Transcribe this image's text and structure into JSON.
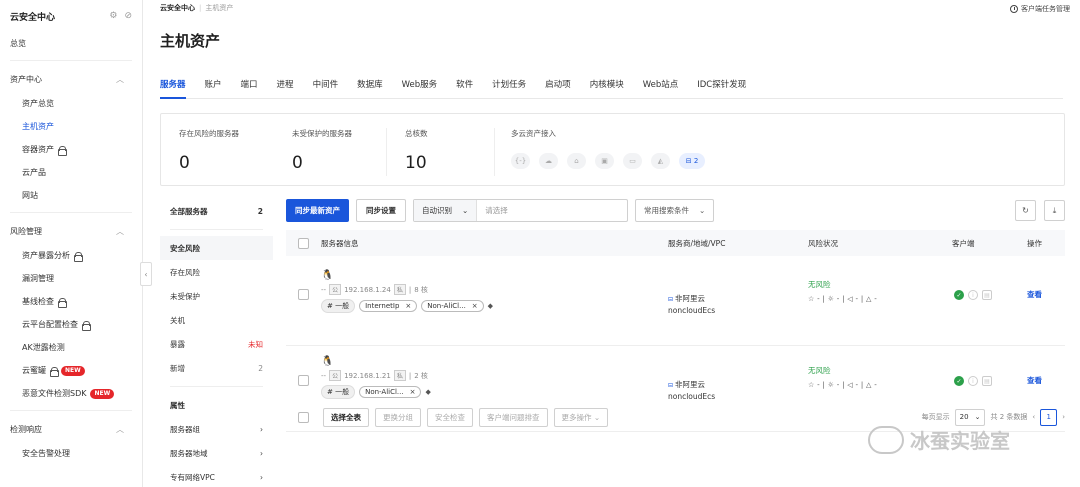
{
  "sidebar": {
    "title": "云安全中心",
    "overview": "总览",
    "groups": [
      {
        "label": "资产中心",
        "items": [
          {
            "label": "资产总览",
            "active": false,
            "lock": false,
            "new": false
          },
          {
            "label": "主机资产",
            "active": true,
            "lock": false,
            "new": false
          },
          {
            "label": "容器资产",
            "active": false,
            "lock": true,
            "new": false
          },
          {
            "label": "云产品",
            "active": false,
            "lock": false,
            "new": false
          },
          {
            "label": "网站",
            "active": false,
            "lock": false,
            "new": false
          }
        ]
      },
      {
        "label": "风险管理",
        "items": [
          {
            "label": "资产暴露分析",
            "active": false,
            "lock": true,
            "new": false
          },
          {
            "label": "漏洞管理",
            "active": false,
            "lock": false,
            "new": false
          },
          {
            "label": "基线检查",
            "active": false,
            "lock": true,
            "new": false
          },
          {
            "label": "云平台配置检查",
            "active": false,
            "lock": true,
            "new": false
          },
          {
            "label": "AK泄露检测",
            "active": false,
            "lock": false,
            "new": false
          },
          {
            "label": "云蜜罐",
            "active": false,
            "lock": true,
            "new": true
          },
          {
            "label": "恶意文件检测SDK",
            "active": false,
            "lock": false,
            "new": true
          }
        ]
      },
      {
        "label": "检测响应",
        "items": [
          {
            "label": "安全告警处理",
            "active": false,
            "lock": false,
            "new": false
          }
        ]
      }
    ],
    "new_label": "NEW"
  },
  "breadcrumb": {
    "current": "云安全中心",
    "sub": "主机资产"
  },
  "top_right": "客户端任务管理",
  "page_title": "主机资产",
  "tabs": [
    "服务器",
    "账户",
    "端口",
    "进程",
    "中间件",
    "数据库",
    "Web服务",
    "软件",
    "计划任务",
    "启动项",
    "内核模块",
    "Web站点",
    "IDC探针发现"
  ],
  "stats": {
    "at_risk": {
      "label": "存在风险的服务器",
      "value": "0"
    },
    "unprotected": {
      "label": "未受保护的服务器",
      "value": "0"
    },
    "cores": {
      "label": "总核数",
      "value": "10"
    },
    "multicloud": {
      "label": "多云资产接入",
      "active_count": "2"
    }
  },
  "left_panel": {
    "all": {
      "label": "全部服务器",
      "count": "2"
    },
    "security_title": "安全风险",
    "security_items": [
      {
        "label": "存在风险",
        "value": ""
      },
      {
        "label": "未受保护",
        "value": ""
      },
      {
        "label": "关机",
        "value": ""
      },
      {
        "label": "暴露",
        "value": "未知"
      },
      {
        "label": "新增",
        "value": "2"
      }
    ],
    "attr_title": "属性",
    "attr_items": [
      {
        "label": "服务器组"
      },
      {
        "label": "服务器地域"
      },
      {
        "label": "专有网络VPC"
      }
    ]
  },
  "toolbar": {
    "sync_assets": "同步最新资产",
    "sync_settings": "同步设置",
    "auto_detect": "自动识别",
    "search_placeholder": "请选择",
    "common_conditions": "常用搜索条件"
  },
  "table": {
    "headers": {
      "info": "服务器信息",
      "vendor": "服务商/地域/VPC",
      "risk": "风险状况",
      "client": "客户端",
      "op": "操作"
    },
    "rows": [
      {
        "name": "--",
        "pub": "公",
        "ip": "192.168.1.24",
        "priv": "私",
        "cores": "8 核",
        "tags": [
          "# 一般",
          "InternetIp",
          "Non-AliCl..."
        ],
        "vendor": "非阿里云",
        "vendor_sub": "noncloudEcs",
        "risk": "无风险",
        "risk_icons": "☆ - | ☼ - | ◁ - | △ -",
        "action": "查看"
      },
      {
        "name": "--",
        "pub": "公",
        "ip": "192.168.1.21",
        "priv": "私",
        "cores": "2 核",
        "tags": [
          "# 一般",
          "Non-AliCl..."
        ],
        "vendor": "非阿里云",
        "vendor_sub": "noncloudEcs",
        "risk": "无风险",
        "risk_icons": "☆ - | ☼ - | ◁ - | △ -",
        "action": "查看"
      }
    ]
  },
  "footer": {
    "select_all": "选择全表",
    "change_group": "更换分组",
    "security_check": "安全检查",
    "client_troubleshoot": "客户端问题排查",
    "more_ops": "更多操作",
    "per_page_label": "每页显示",
    "per_page": "20",
    "total": "共 2 条数据",
    "page": "1"
  },
  "watermark": "冰蚕实验室"
}
